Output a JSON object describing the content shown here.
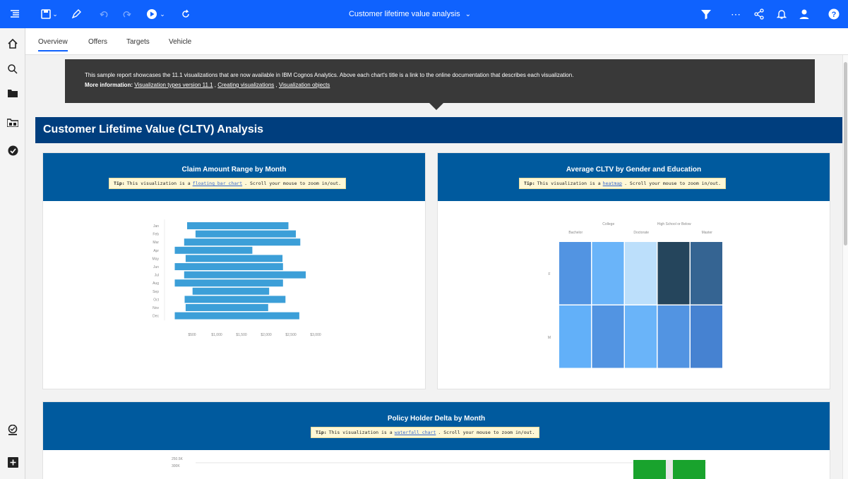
{
  "topbar": {
    "title": "Customer lifetime value analysis",
    "icons": [
      "menu-icon",
      "save-icon",
      "edit-icon",
      "undo-icon",
      "redo-icon",
      "play-icon",
      "refresh-icon",
      "filter-icon",
      "more-icon",
      "share-icon",
      "notification-icon",
      "user-icon",
      "help-icon"
    ]
  },
  "tabs": [
    "Overview",
    "Offers",
    "Targets",
    "Vehicle"
  ],
  "note": {
    "text": "This sample report showcases the 11.1 visualizations that are now available in IBM Cognos Analytics. Above each chart's title is a link to the online documentation that describes each visualization.",
    "more_label": "More information:",
    "links": [
      "Visualization types version 11.1",
      "Creating visualizations",
      "Visualization objects"
    ],
    "separator": " , "
  },
  "section_title": "Customer Lifetime Value (CLTV) Analysis",
  "cards": [
    {
      "title": "Claim Amount Range by Month",
      "tip_label": "Tip:",
      "tip_pre": "This visualization is a",
      "tip_link": "floating bar chart",
      "tip_post": ". Scroll your mouse to zoom in/out."
    },
    {
      "title": "Average CLTV by Gender and Education",
      "tip_label": "Tip:",
      "tip_pre": "This visualization is a",
      "tip_link": "heatmap",
      "tip_post": ". Scroll your mouse to zoom in/out."
    },
    {
      "title": "Policy Holder Delta by Month",
      "tip_label": "Tip:",
      "tip_pre": "This visualization is a",
      "tip_link": "waterfall chart",
      "tip_post": ". Scroll your mouse to zoom in/out."
    }
  ],
  "chart_data": [
    {
      "type": "bar",
      "subtype": "floating",
      "orientation": "horizontal",
      "categories": [
        "Jan",
        "Feb",
        "Mar",
        "Apr",
        "May",
        "Jun",
        "Jul",
        "Aug",
        "Sep",
        "Oct",
        "Nov",
        "Dec"
      ],
      "ranges": [
        [
          400,
          2450
        ],
        [
          570,
          2600
        ],
        [
          340,
          2690
        ],
        [
          150,
          1720
        ],
        [
          370,
          2330
        ],
        [
          150,
          2340
        ],
        [
          340,
          2800
        ],
        [
          150,
          2340
        ],
        [
          510,
          2060
        ],
        [
          350,
          2390
        ],
        [
          370,
          2040
        ],
        [
          150,
          2670
        ]
      ],
      "x_ticks": [
        "$500",
        "$1,000",
        "$1,500",
        "$2,000",
        "$2,500",
        "$3,000"
      ],
      "xlim": [
        0,
        3000
      ],
      "color": "#3c9fd8"
    },
    {
      "type": "heatmap",
      "columns": [
        "Bachelor",
        "College",
        "Doctorate",
        "High School or Below",
        "Master"
      ],
      "rows": [
        "F",
        "M"
      ],
      "cell_colors": [
        [
          "#5294e2",
          "#6ab4f9",
          "#bcdffb",
          "#25455c",
          "#356492"
        ],
        [
          "#62b0f9",
          "#5294e2",
          "#6ab4f9",
          "#5294e2",
          "#4682d1"
        ]
      ]
    },
    {
      "type": "waterfall",
      "y_ticks": [
        "250.5K",
        "300K"
      ]
    }
  ]
}
